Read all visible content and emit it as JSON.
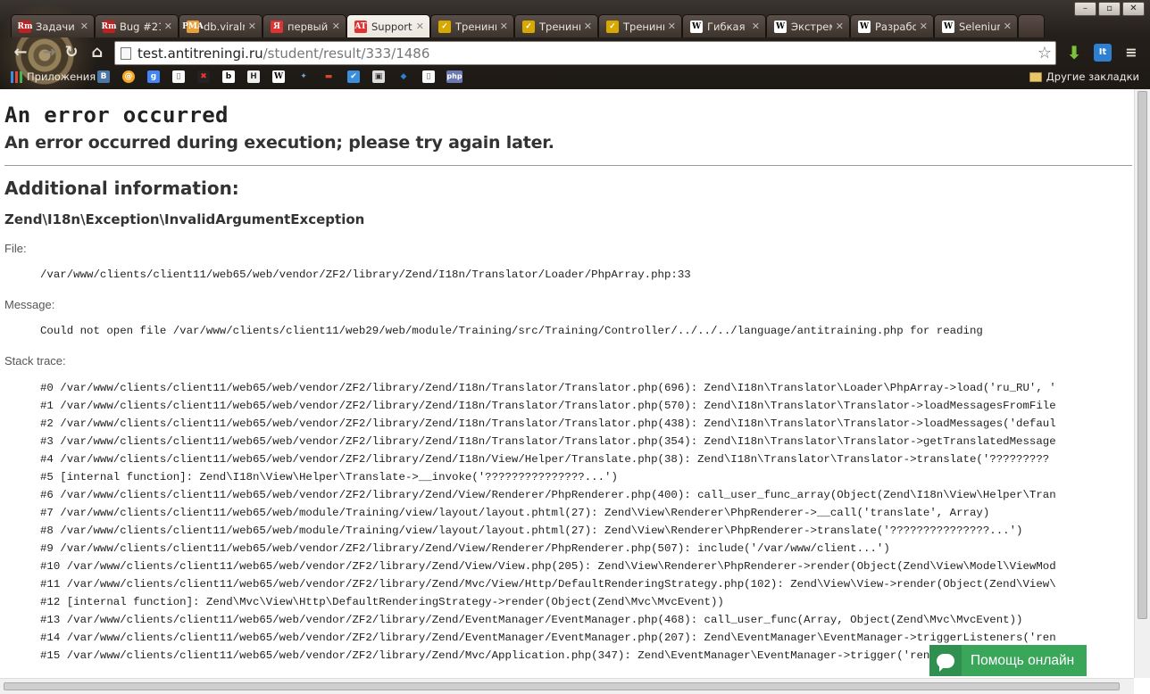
{
  "browser": {
    "tabs": [
      {
        "title": "Задачи",
        "fav": "Rm",
        "favColor": "#b22"
      },
      {
        "title": "Bug #21",
        "fav": "Rm",
        "favColor": "#b22"
      },
      {
        "title": "db.viralr",
        "fav": "PMA",
        "favColor": "#e8a13a"
      },
      {
        "title": "первый",
        "fav": "Я",
        "favColor": "#d33"
      },
      {
        "title": "Support",
        "fav": "AT",
        "favColor": "#d33",
        "active": true
      },
      {
        "title": "Тренинг",
        "fav": "✓",
        "favColor": "#d6a800"
      },
      {
        "title": "Тренинг",
        "fav": "✓",
        "favColor": "#d6a800"
      },
      {
        "title": "Тренинг",
        "fav": "✓",
        "favColor": "#d6a800"
      },
      {
        "title": "Гибкая",
        "fav": "W",
        "favColor": "#fff"
      },
      {
        "title": "Экстрем",
        "fav": "W",
        "favColor": "#fff"
      },
      {
        "title": "Разрабо",
        "fav": "W",
        "favColor": "#fff"
      },
      {
        "title": "Selenium",
        "fav": "W",
        "favColor": "#fff"
      }
    ],
    "url_host": "test.antitreningi.ru",
    "url_path": "/student/result/333/1486",
    "apps_label": "Приложения",
    "other_bookmarks_label": "Другие закладки",
    "ext_label": "It"
  },
  "page": {
    "title": "An error occurred",
    "subtitle": "An error occurred during execution; please try again later.",
    "additional_heading": "Additional information:",
    "exception_class": "Zend\\I18n\\Exception\\InvalidArgumentException",
    "file_label": "File:",
    "file_value": "/var/www/clients/client11/web65/web/vendor/ZF2/library/Zend/I18n/Translator/Loader/PhpArray.php:33",
    "message_label": "Message:",
    "message_value": "Could not open file /var/www/clients/client11/web29/web/module/Training/src/Training/Controller/../../../language/antitraining.php for reading",
    "stack_label": "Stack trace:",
    "stack_trace": [
      "#0 /var/www/clients/client11/web65/web/vendor/ZF2/library/Zend/I18n/Translator/Translator.php(696): Zend\\I18n\\Translator\\Loader\\PhpArray->load('ru_RU', '",
      "#1 /var/www/clients/client11/web65/web/vendor/ZF2/library/Zend/I18n/Translator/Translator.php(570): Zend\\I18n\\Translator\\Translator->loadMessagesFromFile",
      "#2 /var/www/clients/client11/web65/web/vendor/ZF2/library/Zend/I18n/Translator/Translator.php(438): Zend\\I18n\\Translator\\Translator->loadMessages('defaul",
      "#3 /var/www/clients/client11/web65/web/vendor/ZF2/library/Zend/I18n/Translator/Translator.php(354): Zend\\I18n\\Translator\\Translator->getTranslatedMessage",
      "#4 /var/www/clients/client11/web65/web/vendor/ZF2/library/Zend/I18n/View/Helper/Translate.php(38): Zend\\I18n\\Translator\\Translator->translate('?????????",
      "#5 [internal function]: Zend\\I18n\\View\\Helper\\Translate->__invoke('???????????????...')",
      "#6 /var/www/clients/client11/web65/web/vendor/ZF2/library/Zend/View/Renderer/PhpRenderer.php(400): call_user_func_array(Object(Zend\\I18n\\View\\Helper\\Tran",
      "#7 /var/www/clients/client11/web65/web/module/Training/view/layout/layout.phtml(27): Zend\\View\\Renderer\\PhpRenderer->__call('translate', Array)",
      "#8 /var/www/clients/client11/web65/web/module/Training/view/layout/layout.phtml(27): Zend\\View\\Renderer\\PhpRenderer->translate('???????????????...')",
      "#9 /var/www/clients/client11/web65/web/vendor/ZF2/library/Zend/View/Renderer/PhpRenderer.php(507): include('/var/www/client...')",
      "#10 /var/www/clients/client11/web65/web/vendor/ZF2/library/Zend/View/View.php(205): Zend\\View\\Renderer\\PhpRenderer->render(Object(Zend\\View\\Model\\ViewMod",
      "#11 /var/www/clients/client11/web65/web/vendor/ZF2/library/Zend/Mvc/View/Http/DefaultRenderingStrategy.php(102): Zend\\View\\View->render(Object(Zend\\View\\",
      "#12 [internal function]: Zend\\Mvc\\View\\Http\\DefaultRenderingStrategy->render(Object(Zend\\Mvc\\MvcEvent))",
      "#13 /var/www/clients/client11/web65/web/vendor/ZF2/library/Zend/EventManager/EventManager.php(468): call_user_func(Array, Object(Zend\\Mvc\\MvcEvent))",
      "#14 /var/www/clients/client11/web65/web/vendor/ZF2/library/Zend/EventManager/EventManager.php(207): Zend\\EventManager\\EventManager->triggerListeners('ren",
      "#15 /var/www/clients/client11/web65/web/vendor/ZF2/library/Zend/Mvc/Application.php(347): Zend\\EventManager\\EventManager->trigger('render', Object(Zend\\M"
    ]
  },
  "help_widget": {
    "label": "Помощь онлайн"
  }
}
